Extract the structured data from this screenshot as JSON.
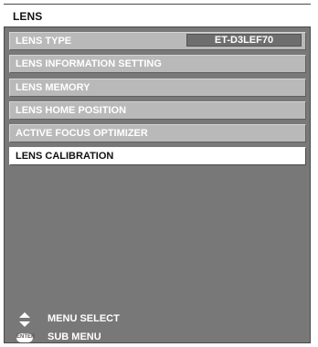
{
  "title": "LENS",
  "menu": {
    "items": [
      {
        "label": "LENS TYPE",
        "value": "ET-D3LEF70"
      },
      {
        "label": "LENS INFORMATION SETTING"
      },
      {
        "label": "LENS MEMORY"
      },
      {
        "label": "LENS HOME POSITION"
      },
      {
        "label": "ACTIVE FOCUS OPTIMIZER"
      },
      {
        "label": "LENS CALIBRATION",
        "selected": true
      }
    ]
  },
  "footer": {
    "menu_select": {
      "icon": "up-down-arrow-icon",
      "text": "MENU SELECT"
    },
    "sub_menu": {
      "icon": "enter-button-icon",
      "icon_text": "ENTER",
      "text": "SUB MENU"
    }
  },
  "colors": {
    "panel": "#787878",
    "item": "#b9b9b9",
    "selected": "#ffffff",
    "value_box": "#6e6e6e"
  }
}
